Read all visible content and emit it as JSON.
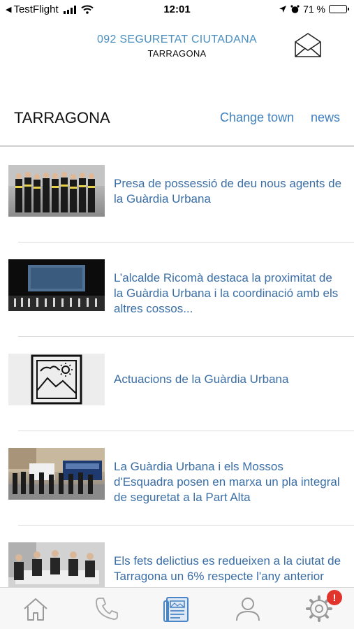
{
  "status_bar": {
    "carrier": "TestFlight",
    "time": "12:01",
    "battery": "71 %",
    "battery_level": 0.71
  },
  "header": {
    "title": "092 SEGURETAT CIUTADANA",
    "subtitle": "TARRAGONA"
  },
  "town_bar": {
    "town": "TARRAGONA",
    "change_town": "Change town",
    "news": "news"
  },
  "news": [
    {
      "title": "Presa de possessió de deu nous agents de la Guàrdia Urbana"
    },
    {
      "title": "L’alcalde Ricomà destaca la proximitat de la Guàrdia Urbana i la coordinació amb els altres cossos..."
    },
    {
      "title": "Actuacions de la Guàrdia Urbana"
    },
    {
      "title": "La Guàrdia Urbana i els Mossos d'Esquadra posen en marxa un pla integral de seguretat a la Part Alta"
    },
    {
      "title": "Els fets delictius es redueixen a la ciutat de Tarragona un 6% respecte l'any anterior"
    }
  ],
  "tab_bar": {
    "tabs": [
      "home-icon",
      "phone-icon",
      "news-icon",
      "user-icon",
      "settings-icon"
    ],
    "active_tab": "news-icon",
    "settings_badge": "!"
  },
  "colors": {
    "accent": "#3f7fbf",
    "header_title": "#4a8fc0",
    "badge": "#e0342c"
  }
}
